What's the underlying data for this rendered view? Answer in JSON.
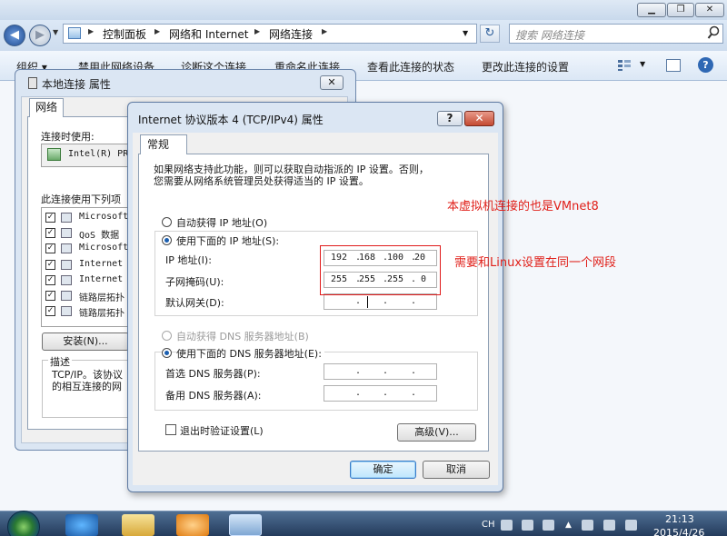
{
  "explorer": {
    "caption_buttons": {
      "minimize": "▁",
      "maximize": "❐",
      "close": "✕"
    },
    "breadcrumbs": [
      "控制面板",
      "网络和 Internet",
      "网络连接"
    ],
    "search_placeholder": "搜索 网络连接",
    "commands": [
      "组织 ▾",
      "禁用此网络设备",
      "诊断这个连接",
      "重命名此连接",
      "查看此连接的状态",
      "更改此连接的设置"
    ],
    "help": "?"
  },
  "lan_dialog": {
    "title": "本地连接 属性",
    "close": "✕",
    "tab": "网络",
    "connect_using_label": "连接时使用:",
    "adapter": "Intel(R) PR",
    "items_label": "此连接使用下列项",
    "items": [
      {
        "checked": "✓",
        "text": "Microsoft"
      },
      {
        "checked": "✓",
        "text": "QoS 数据"
      },
      {
        "checked": "✓",
        "text": "Microsoft"
      },
      {
        "checked": "✓",
        "text": "Internet"
      },
      {
        "checked": "✓",
        "text": "Internet"
      },
      {
        "checked": "✓",
        "text": "链路层拓扑"
      },
      {
        "checked": "✓",
        "text": "链路层拓扑"
      }
    ],
    "install_button": "安装(N)...",
    "description_title": "描述",
    "description_text": "TCP/IP。该协议\n的相互连接的网"
  },
  "ipv4_dialog": {
    "title": "Internet 协议版本 4 (TCP/IPv4) 属性",
    "help": "?",
    "close": "✕",
    "tab": "常规",
    "info": "如果网络支持此功能，则可以获取自动指派的 IP 设置。否则，\n您需要从网络系统管理员处获得适当的 IP 设置。",
    "auto_ip_label": "自动获得 IP 地址(O)",
    "manual_ip_label": "使用下面的 IP 地址(S):",
    "ip_label": "IP 地址(I):",
    "ip_value": [
      "192",
      "168",
      "100",
      "20"
    ],
    "mask_label": "子网掩码(U):",
    "mask_value": [
      "255",
      "255",
      "255",
      "0"
    ],
    "gateway_label": "默认网关(D):",
    "auto_dns_label": "自动获得 DNS 服务器地址(B)",
    "manual_dns_label": "使用下面的 DNS 服务器地址(E):",
    "preferred_dns_label": "首选 DNS 服务器(P):",
    "alternate_dns_label": "备用 DNS 服务器(A):",
    "validate_label": "退出时验证设置(L)",
    "advanced_button": "高级(V)...",
    "ok_button": "确定",
    "cancel_button": "取消",
    "ip_dots": "."
  },
  "annotations": {
    "note_1": "本虚拟机连接的也是VMnet8",
    "note_2": "需要和Linux设置在同一个网段",
    "color": "#e0201a"
  },
  "taskbar": {
    "language": "CH",
    "time": "21:13",
    "date": "2015/4/26"
  }
}
